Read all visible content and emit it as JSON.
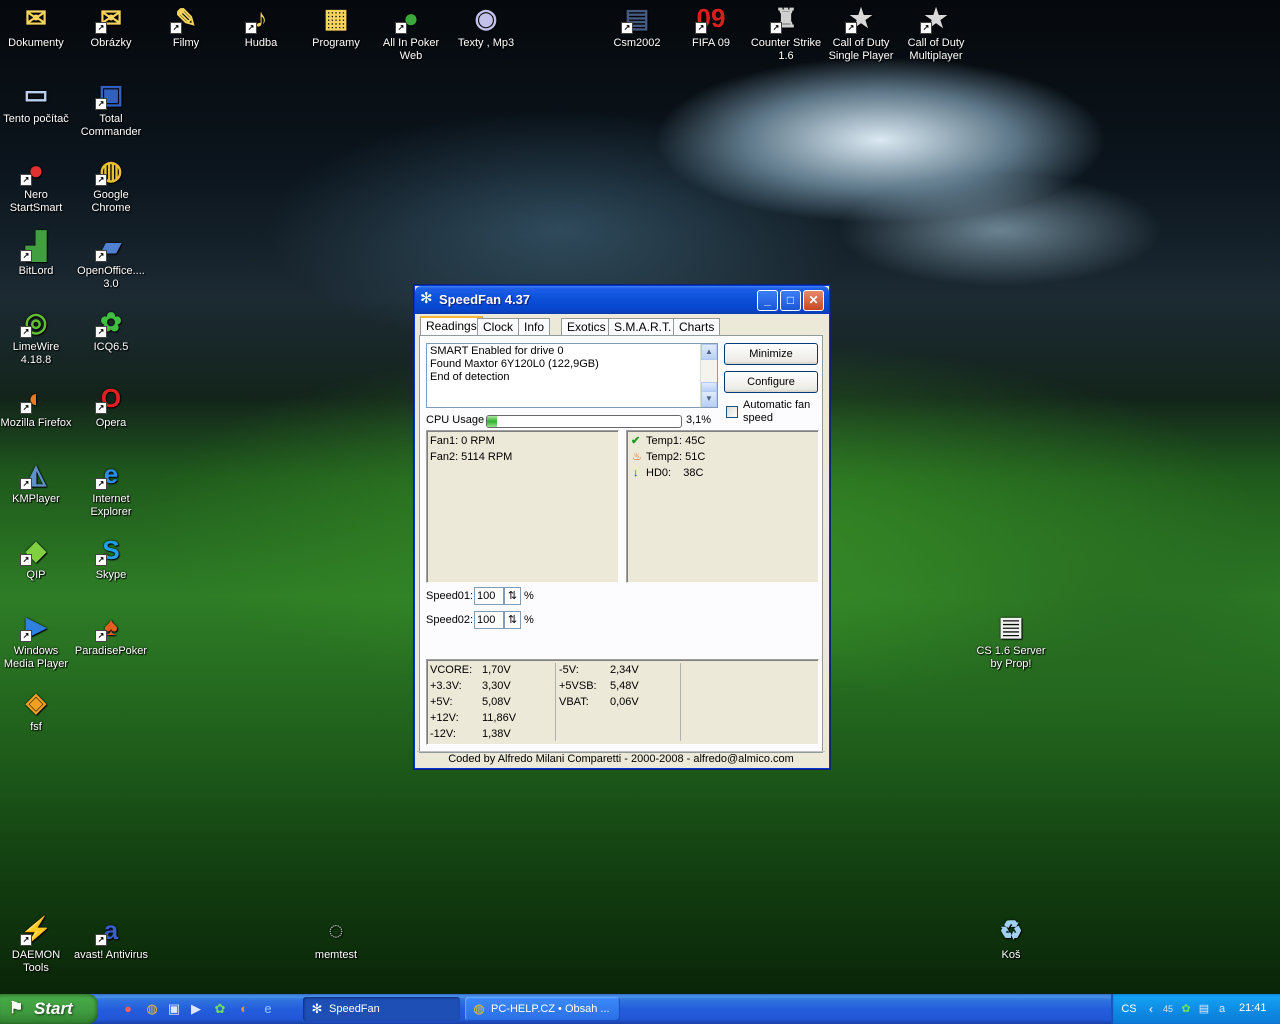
{
  "desktop_icons": [
    {
      "label": "Dokumenty",
      "glyph": "✉",
      "color": "#f4d35e",
      "shortcut": false
    },
    {
      "label": "Obrázky",
      "glyph": "✉",
      "color": "#f4d35e",
      "shortcut": true
    },
    {
      "label": "Filmy",
      "glyph": "✎",
      "color": "#f4d35e",
      "shortcut": true
    },
    {
      "label": "Hudba",
      "glyph": "♪",
      "color": "#f4d35e",
      "shortcut": true
    },
    {
      "label": "Programy",
      "glyph": "▦",
      "color": "#f4d35e",
      "shortcut": false
    },
    {
      "label": "All In Poker Web",
      "glyph": "●",
      "color": "#3aa83a",
      "shortcut": true
    },
    {
      "label": "Texty , Mp3",
      "glyph": "◉",
      "color": "#c0c0e8",
      "shortcut": false
    },
    {
      "label": "Csm2002",
      "glyph": "▤",
      "color": "#455a80",
      "shortcut": true
    },
    {
      "label": "FIFA 09",
      "glyph": "09",
      "color": "#d82020",
      "shortcut": true
    },
    {
      "label": "Counter Strike 1.6",
      "glyph": "♜",
      "color": "#d0d0d0",
      "shortcut": true
    },
    {
      "label": "Call of Duty Single Player",
      "glyph": "★",
      "color": "#d8d8d8",
      "shortcut": true
    },
    {
      "label": "Call of Duty Multiplayer",
      "glyph": "★",
      "color": "#d8d8d8",
      "shortcut": true
    },
    {
      "label": "Tento počítač",
      "glyph": "▭",
      "color": "#b8d0f0",
      "shortcut": false
    },
    {
      "label": "Total Commander",
      "glyph": "▣",
      "color": "#3060c0",
      "shortcut": true
    },
    {
      "label": "Nero StartSmart",
      "glyph": "●",
      "color": "#e03030",
      "shortcut": true
    },
    {
      "label": "Google Chrome",
      "glyph": "◍",
      "color": "#e8c030",
      "shortcut": true
    },
    {
      "label": "BitLord",
      "glyph": "▟",
      "color": "#40a040",
      "shortcut": true
    },
    {
      "label": "OpenOffice.... 3.0",
      "glyph": "▰",
      "color": "#5080d0",
      "shortcut": true
    },
    {
      "label": "LimeWire 4.18.8",
      "glyph": "◎",
      "color": "#60c030",
      "shortcut": true
    },
    {
      "label": "ICQ6.5",
      "glyph": "✿",
      "color": "#40c040",
      "shortcut": true
    },
    {
      "label": "Mozilla Firefox",
      "glyph": "◐",
      "color": "#e87a20",
      "shortcut": true
    },
    {
      "label": "Opera",
      "glyph": "O",
      "color": "#e02020",
      "shortcut": true
    },
    {
      "label": "KMPlayer",
      "glyph": "◭",
      "color": "#6090c8",
      "shortcut": true
    },
    {
      "label": "Internet Explorer",
      "glyph": "e",
      "color": "#2f8fe8",
      "shortcut": true
    },
    {
      "label": "QIP",
      "glyph": "◆",
      "color": "#80d040",
      "shortcut": true
    },
    {
      "label": "Skype",
      "glyph": "S",
      "color": "#1fa0e8",
      "shortcut": true
    },
    {
      "label": "Windows Media Player",
      "glyph": "▶",
      "color": "#3080e0",
      "shortcut": true
    },
    {
      "label": "ParadisePoker",
      "glyph": "♠",
      "color": "#e06020",
      "shortcut": true
    },
    {
      "label": "fsf",
      "glyph": "◈",
      "color": "#f0a020",
      "shortcut": false
    },
    {
      "label": "CS 1.6 Server by Prop!",
      "glyph": "▤",
      "color": "#f0f0f0",
      "shortcut": false
    },
    {
      "label": "DAEMON Tools",
      "glyph": "⚡",
      "color": "#4070c0",
      "shortcut": true
    },
    {
      "label": "avast! Antivirus",
      "glyph": "a",
      "color": "#3a5fd0",
      "shortcut": true
    },
    {
      "label": "memtest",
      "glyph": "◌",
      "color": "#d0d0d0",
      "shortcut": false
    },
    {
      "label": "Koš",
      "glyph": "♻",
      "color": "#9fd0f0",
      "shortcut": false
    }
  ],
  "window": {
    "title": "SpeedFan 4.37",
    "minimize_glyph": "_",
    "maximize_glyph": "□",
    "close_glyph": "✕",
    "tabs": [
      "Readings",
      "Clock",
      "Info",
      "Exotics",
      "S.M.A.R.T.",
      "Charts"
    ],
    "active_tab": "Readings",
    "log_lines": [
      "SMART Enabled for drive 0",
      "Found Maxtor 6Y120L0 (122,9GB)",
      "End of detection"
    ],
    "minimize_button": "Minimize",
    "configure_button": "Configure",
    "auto_fan_label": "Automatic fan speed",
    "auto_fan_checked": false,
    "cpu_usage_label": "CPU Usage",
    "cpu_usage_value": "3,1%",
    "cpu_usage_fraction": 0.031,
    "fans": [
      "Fan1: 0 RPM",
      "Fan2: 5114 RPM"
    ],
    "temps": [
      {
        "icon": "check-icon",
        "label": "Temp1: 45C"
      },
      {
        "icon": "flame-icon",
        "label": "Temp2: 51C"
      },
      {
        "icon": "down-arrow-icon",
        "label": "HD0:    38C"
      }
    ],
    "speeds": [
      {
        "label": "Speed01:",
        "value": "100",
        "unit": "%"
      },
      {
        "label": "Speed02:",
        "value": "100",
        "unit": "%"
      }
    ],
    "voltages_left": [
      {
        "name": "VCORE:",
        "value": "1,70V"
      },
      {
        "name": "+3.3V:",
        "value": "3,30V"
      },
      {
        "name": "+5V:",
        "value": "5,08V"
      },
      {
        "name": "+12V:",
        "value": "11,86V"
      },
      {
        "name": "-12V:",
        "value": "1,38V"
      }
    ],
    "voltages_right": [
      {
        "name": "-5V:",
        "value": "2,34V"
      },
      {
        "name": "+5VSB:",
        "value": "5,48V"
      },
      {
        "name": "VBAT:",
        "value": "0,06V"
      }
    ],
    "credit": "Coded by Alfredo Milani Comparetti - 2000-2008 - alfredo@almico.com"
  },
  "taskbar": {
    "start_label": "Start",
    "quick_launch": [
      "nero-icon",
      "chrome-icon",
      "total-commander-icon",
      "media-player-icon",
      "icq-icon",
      "firefox-icon",
      "ie-icon"
    ],
    "buttons": [
      {
        "label": "SpeedFan",
        "active": true
      },
      {
        "label": "PC-HELP.CZ • Obsah ...",
        "active": false
      }
    ],
    "tray": {
      "language": "CS",
      "badge": "45",
      "clock": "21:41"
    }
  }
}
